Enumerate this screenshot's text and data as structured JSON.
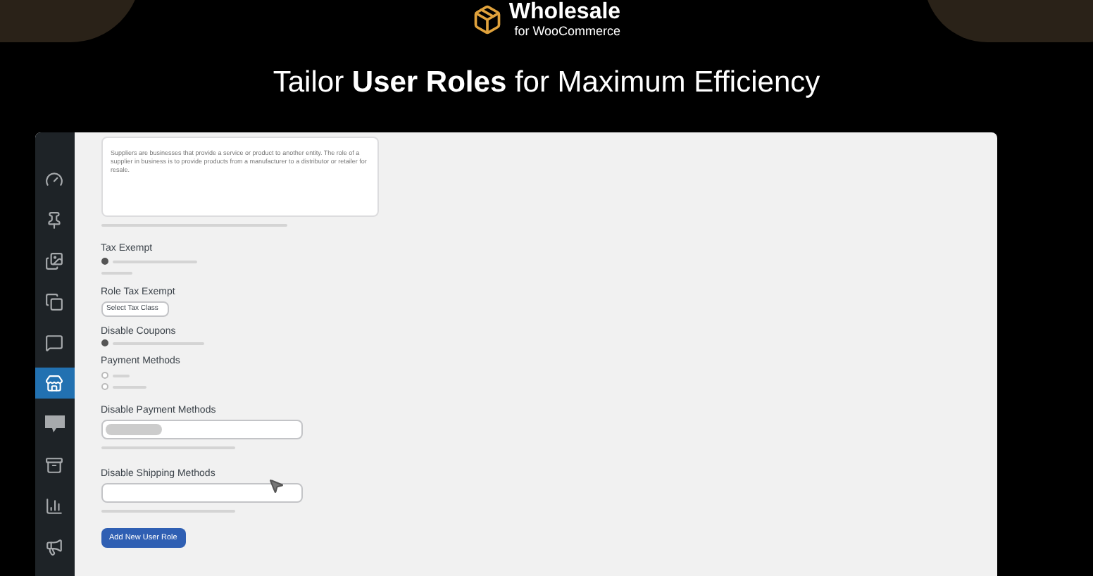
{
  "header": {
    "logo_title": "Wholesale",
    "logo_subtitle": "for WooCommerce",
    "headline": "Tailor **User Roles** for Maximum Efficiency"
  },
  "sidebar": {
    "items": [
      {
        "selected": false
      },
      {
        "selected": false
      },
      {
        "selected": false
      },
      {
        "selected": false
      },
      {
        "selected": false
      },
      {
        "selected": true
      },
      {
        "selected": false
      },
      {
        "selected": false
      },
      {
        "selected": false
      },
      {
        "selected": false
      }
    ]
  },
  "form": {
    "description": "Suppliers are businesses that provide a service or product to another entity. The role of a supplier in business is to provide products from a manufacturer to a distributor or retailer for resale.",
    "tax_exempt": {
      "label": "Tax Exempt",
      "checked": true
    },
    "role_tax_exempt": {
      "label": "Role Tax Exempt",
      "value": "Select Tax Class"
    },
    "disable_coupons": {
      "label": "Disable Coupons",
      "checked": true
    },
    "payment_methods": {
      "label": "Payment Methods",
      "options": [
        {
          "selected": false
        },
        {
          "selected": false
        }
      ]
    },
    "disable_payment_methods": {
      "label": "Disable Payment Methods"
    },
    "disable_shipping_methods": {
      "label": "Disable Shipping Methods"
    },
    "submit": "Add New User Role"
  }
}
